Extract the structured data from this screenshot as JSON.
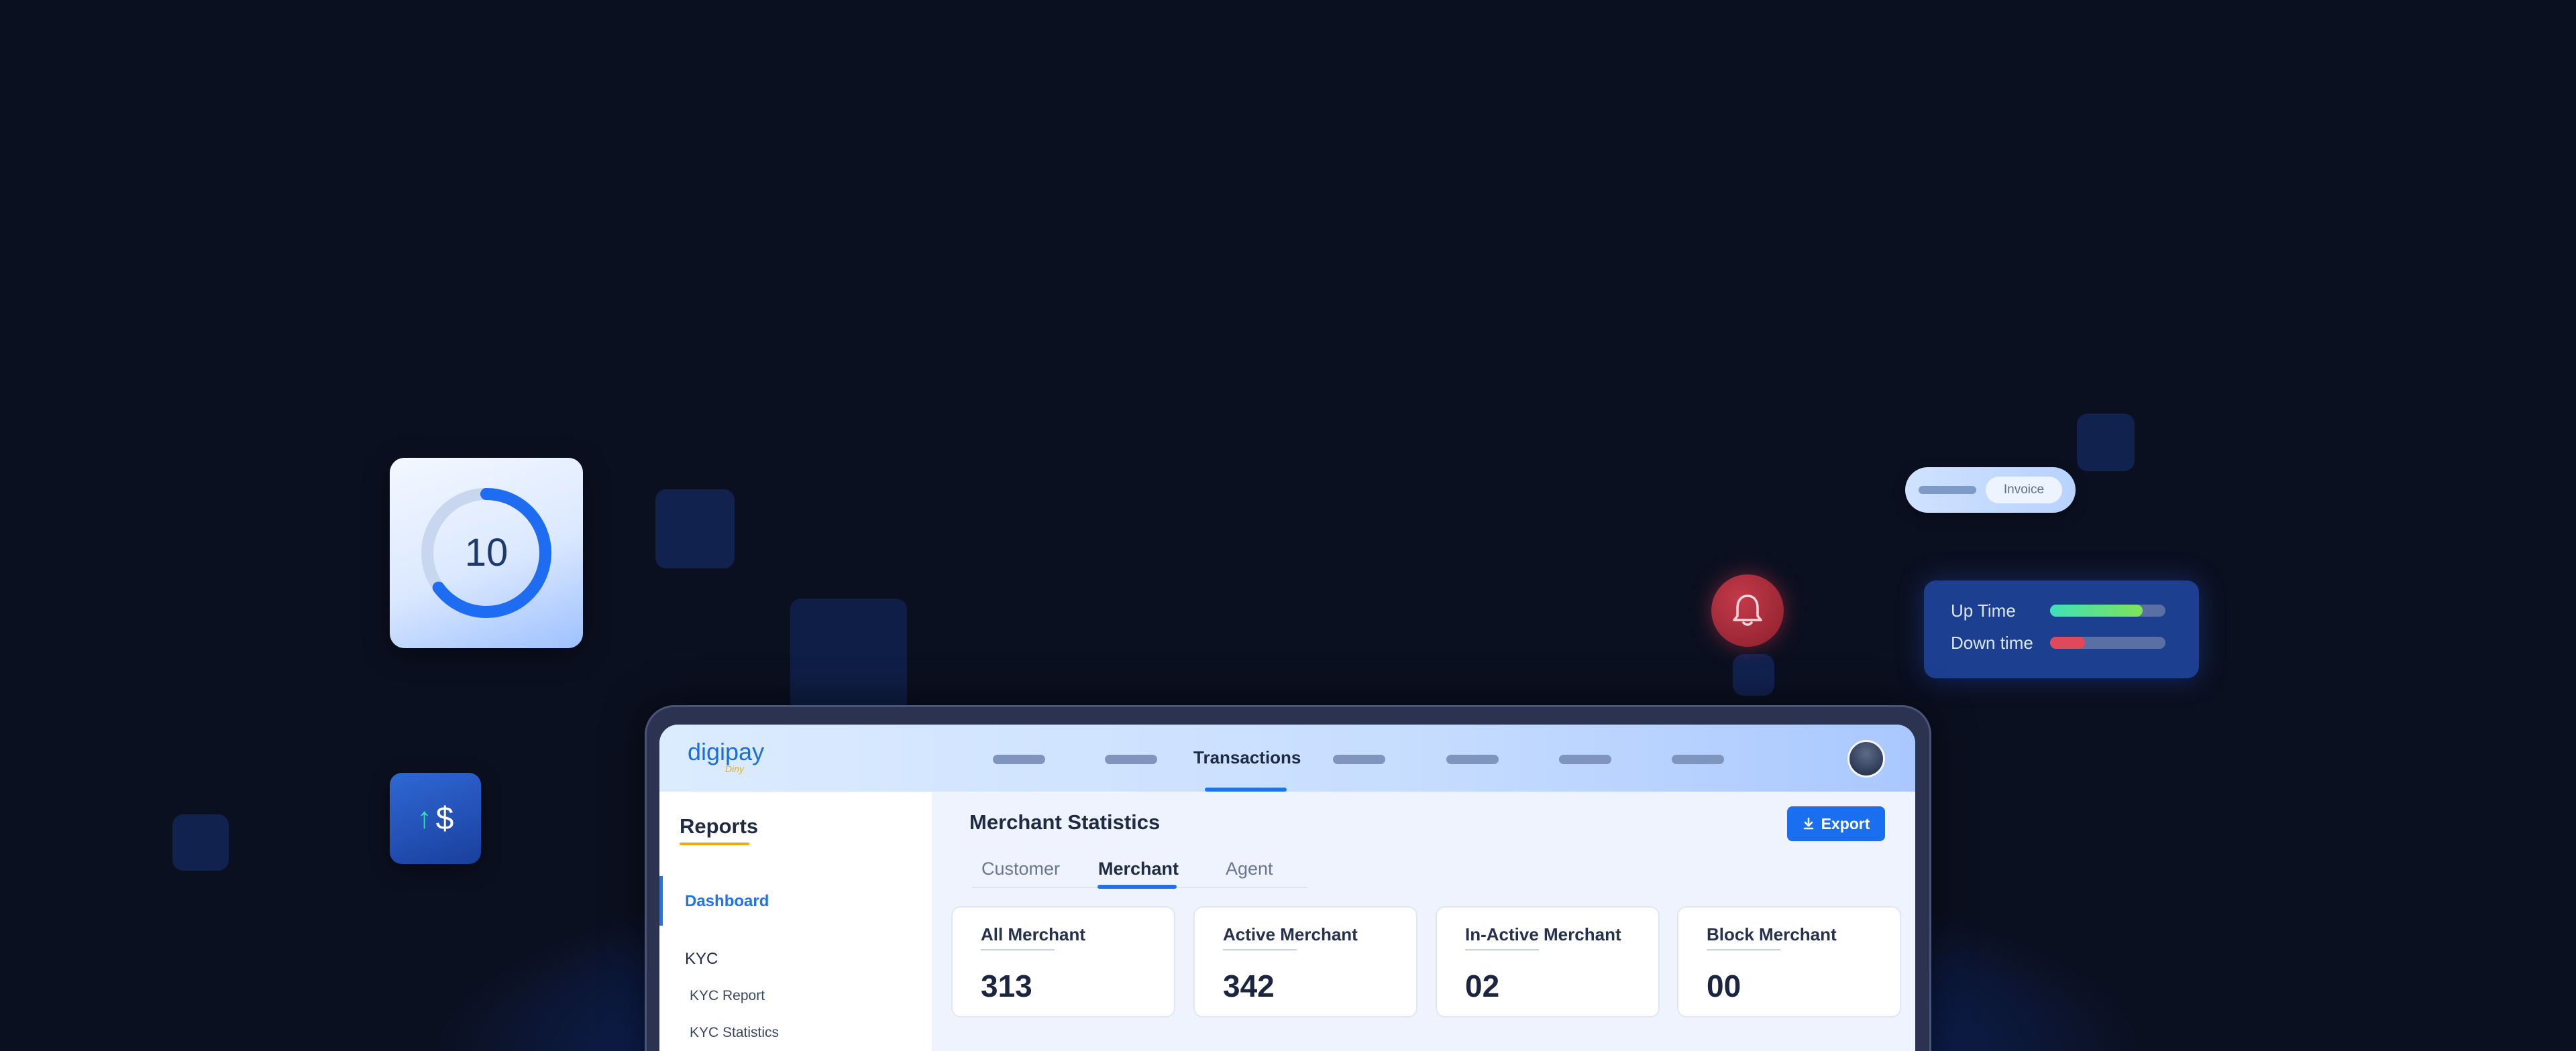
{
  "ring_widget": {
    "value": "10",
    "progress": 0.65
  },
  "money_widget": {
    "arrow": "↑",
    "symbol": "$"
  },
  "invoice_widget": {
    "label": "Invoice"
  },
  "uptime_widget": {
    "rows": [
      {
        "label": "Up Time",
        "level": 0.8,
        "color": "#7ee35a"
      },
      {
        "label": "Down time",
        "level": 0.3,
        "color": "#e0485c"
      }
    ]
  },
  "app": {
    "logo": "digipay",
    "logo_sub": "Diny",
    "nav_active": "Transactions"
  },
  "sidebar": {
    "title": "Reports",
    "items": [
      {
        "label": "Dashboard",
        "active": true
      },
      {
        "label": "KYC",
        "active": false
      }
    ],
    "subitems": [
      "KYC Report",
      "KYC Statistics"
    ]
  },
  "main": {
    "title": "Merchant Statistics",
    "export_label": "Export",
    "tabs": [
      "Customer",
      "Merchant",
      "Agent"
    ],
    "active_tab": "Merchant",
    "stats": [
      {
        "label": "All Merchant",
        "value": "313"
      },
      {
        "label": "Active Merchant",
        "value": "342"
      },
      {
        "label": "In-Active Merchant",
        "value": "02"
      },
      {
        "label": "Block Merchant",
        "value": "00"
      }
    ]
  },
  "colors": {
    "accent": "#1e74f0",
    "highlight": "#f2a900",
    "background": "#0b1020"
  }
}
